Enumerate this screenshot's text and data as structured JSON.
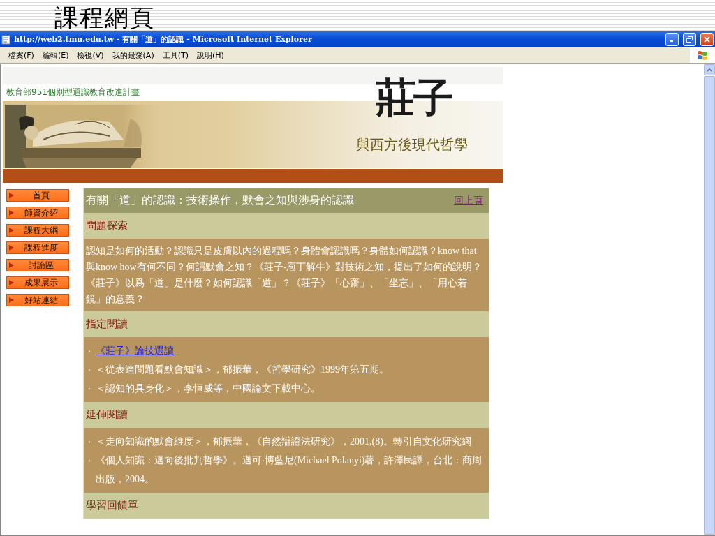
{
  "slide": {
    "title": "課程網頁"
  },
  "window": {
    "title": "http://web2.tmu.edu.tw - 有關「道」的認識 - Microsoft Internet Explorer"
  },
  "menu": [
    "檔案(F)",
    "編輯(E)",
    "檢視(V)",
    "我的最愛(A)",
    "工具(T)",
    "說明(H)"
  ],
  "banner": {
    "program": "教育部951個別型通識教育改進計畫",
    "logo": "莊子",
    "subtitle": "與西方後現代哲學"
  },
  "nav": [
    "首頁",
    "師資介紹",
    "課程大綱",
    "課程進度",
    "討論區",
    "成果展示",
    "好站連結"
  ],
  "article": {
    "title": "有關「道」的認識：技術操作，默會之知與涉身的認識",
    "back_link": "回上頁",
    "sections": [
      {
        "heading": "問題探索",
        "kind": "paragraph",
        "text": "認知是如何的活動？認識只是皮膚以內的過程嗎？身體會認識嗎？身體如何認識？know that與know how有何不同？何謂默會之知？《莊子‧庖丁解牛》對技術之知，提出了如何的說明？《莊子》以爲「道」是什麼？如何認識「道」？《莊子》「心齋」、「坐忘」、「用心若鏡」的意義？"
      },
      {
        "heading": "指定閱讀",
        "kind": "list",
        "items": [
          {
            "bullet": "‧",
            "text": "《莊子》論技選讀",
            "link": true
          },
          {
            "bullet": "‧",
            "text": "＜從表達問題看默會知識＞，郁振華，《哲學研究》1999年第五期。",
            "link": false
          },
          {
            "bullet": "‧",
            "text": "＜認知的具身化＞，李恒威等，中國論文下載中心。",
            "link": false
          }
        ]
      },
      {
        "heading": "延伸閱讀",
        "kind": "list",
        "items": [
          {
            "bullet": "‧",
            "text": "＜走向知識的默會維度＞，郁振華，《自然辯證法研究》，2001,(8)。轉引自文化研究網",
            "link": false
          },
          {
            "bullet": "‧",
            "text": "《個人知識：邁向後批判哲學》。邁可‧博藍尼(Michael Polanyi)著，許澤民譯，台北：商周出版，2004。",
            "link": false
          }
        ]
      },
      {
        "heading": "學習回饋單",
        "kind": "heading"
      }
    ]
  }
}
